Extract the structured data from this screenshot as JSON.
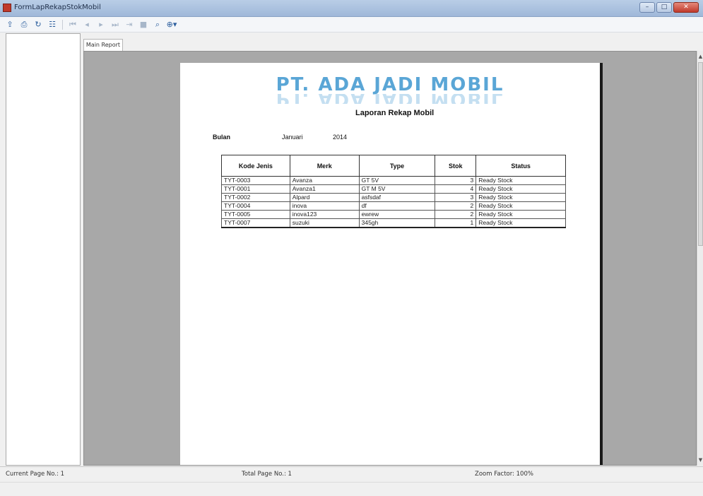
{
  "window": {
    "title": "FormLapRekapStokMobil",
    "min": "–",
    "max": "□",
    "close": "✕"
  },
  "toolbar": {
    "icons": [
      "export-icon",
      "print-icon",
      "refresh-icon",
      "group-tree-icon",
      "first-page-icon",
      "prev-page-icon",
      "next-page-icon",
      "last-page-icon",
      "goto-page-icon",
      "stop-icon",
      "search-icon",
      "zoom-icon"
    ]
  },
  "tab": {
    "label": "Main Report"
  },
  "report": {
    "company": "PT. ADA JADI MOBIL",
    "title": "Laporan Rekap Mobil",
    "period_label": "Bulan",
    "month": "Januari",
    "year": "2014",
    "columns": [
      "Kode Jenis",
      "Merk",
      "Type",
      "Stok",
      "Status"
    ],
    "rows": [
      [
        "TYT-0003",
        "Avanza",
        "GT 5V",
        "3",
        "Ready Stock"
      ],
      [
        "TYT-0001",
        "Avanza1",
        "GT M 5V",
        "4",
        "Ready Stock"
      ],
      [
        "TYT-0002",
        "Alpard",
        "asfsdaf",
        "3",
        "Ready Stock"
      ],
      [
        "TYT-0004",
        "inova",
        "df",
        "2",
        "Ready Stock"
      ],
      [
        "TYT-0005",
        "inova123",
        "ewrew",
        "2",
        "Ready Stock"
      ],
      [
        "TYT-0007",
        "suzuki",
        "345gh",
        "1",
        "Ready Stock"
      ]
    ]
  },
  "status": {
    "current_page": "Current Page No.: 1",
    "total_page": "Total Page No.: 1",
    "zoom": "Zoom Factor: 100%"
  }
}
